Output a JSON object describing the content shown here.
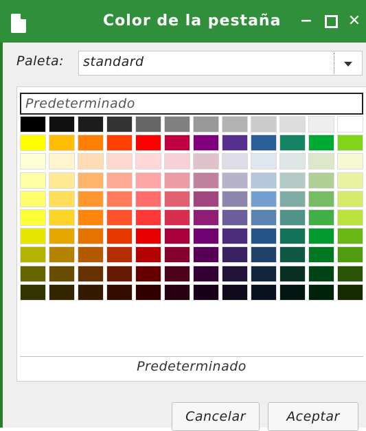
{
  "window": {
    "title": "Color de la pestaña",
    "min_label": "−",
    "close_label": "✕"
  },
  "palette": {
    "label": "Paleta:",
    "value": "standard"
  },
  "default_top": "Predeterminado",
  "default_bottom": "Predeterminado",
  "buttons": {
    "cancel": "Cancelar",
    "accept": "Aceptar"
  },
  "swatches": [
    [
      "#000000",
      "#111111",
      "#1c1c1c",
      "#333333",
      "#666666",
      "#808080",
      "#999999",
      "#b2b2b2",
      "#cccccc",
      "#dddddd",
      "#eeeeee",
      "#ffffff"
    ],
    [
      "#ffff00",
      "#ffbf00",
      "#ff8000",
      "#ff4000",
      "#ff0000",
      "#bf0041",
      "#800080",
      "#55308d",
      "#2a6099",
      "#158466",
      "#00a933",
      "#81d41a"
    ],
    [
      "#ffffd7",
      "#fff5ce",
      "#ffdbb6",
      "#ffd8ce",
      "#ffd7d7",
      "#f7d1d5",
      "#e0c2cd",
      "#dedce6",
      "#dee6ef",
      "#dee7e5",
      "#dde8cb",
      "#f6f9d4"
    ],
    [
      "#ffffa6",
      "#ffe994",
      "#ffb66c",
      "#ffaa95",
      "#ffa6a6",
      "#ec9ba4",
      "#bf819e",
      "#b7b3ca",
      "#b4c7dc",
      "#b3cac7",
      "#afd095",
      "#e8f2a1"
    ],
    [
      "#ffff6d",
      "#ffde59",
      "#ff972f",
      "#ff7b59",
      "#ff6d6d",
      "#e16173",
      "#a1467e",
      "#8e86ae",
      "#729fcf",
      "#81aca6",
      "#77bc65",
      "#d4ea6b"
    ],
    [
      "#ffff38",
      "#ffd428",
      "#ff860d",
      "#ff5429",
      "#ff3838",
      "#d62e4e",
      "#8d1d75",
      "#6b5e9b",
      "#5983b0",
      "#50938a",
      "#3faf46",
      "#bbe33d"
    ],
    [
      "#e6e600",
      "#e6a800",
      "#e67300",
      "#e63900",
      "#e60000",
      "#a9003c",
      "#710071",
      "#4c2d7c",
      "#255588",
      "#137358",
      "#009a2e",
      "#6ab913"
    ],
    [
      "#b3b300",
      "#b38300",
      "#b35900",
      "#b32d00",
      "#b30000",
      "#84002f",
      "#560056",
      "#3a2160",
      "#1d4169",
      "#0f5843",
      "#007823",
      "#519b0e"
    ],
    [
      "#666600",
      "#664b00",
      "#663300",
      "#661a00",
      "#660000",
      "#4b001b",
      "#320032",
      "#221438",
      "#11253c",
      "#092e23",
      "#004314",
      "#2c5407"
    ],
    [
      "#333300",
      "#332500",
      "#331a00",
      "#330d00",
      "#330000",
      "#26000e",
      "#190019",
      "#110a1c",
      "#09121e",
      "#041712",
      "#00210a",
      "#162a04"
    ]
  ]
}
